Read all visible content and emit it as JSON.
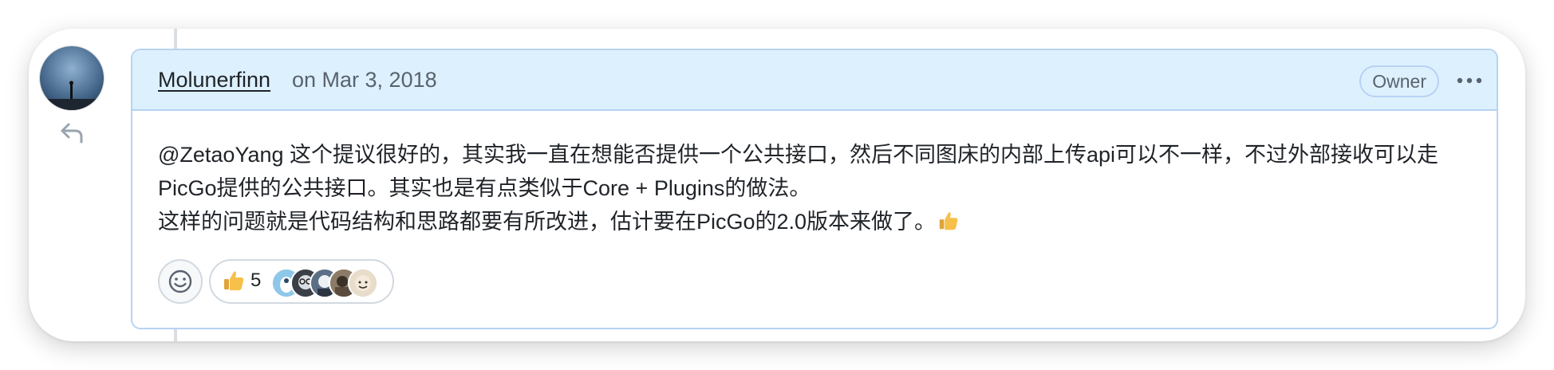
{
  "comment": {
    "author": "Molunerfinn",
    "date": "on Mar 3, 2018",
    "role_badge": "Owner",
    "menu_icon": "kebab-horizontal-icon",
    "body_line1": "@ZetaoYang 这个提议很好的，其实我一直在想能否提供一个公共接口，然后不同图床的内部上传api可以不一样，不过外部接收可以走PicGo提供的公共接口。其实也是有点类似于Core + Plugins的做法。",
    "body_line2": "这样的问题就是代码结构和思路都要有所改进，估计要在PicGo的2.0版本来做了。",
    "body_trailing_emoji": "thumbs-up-emoji"
  },
  "reactions": {
    "add_reaction_icon": "smiley-icon",
    "items": [
      {
        "emoji": "thumbs-up-emoji",
        "count": "5"
      }
    ]
  },
  "colors": {
    "header_bg": "#ddf0fd",
    "border": "#b6d3f2",
    "text": "#1f2328",
    "muted": "#59636e"
  }
}
